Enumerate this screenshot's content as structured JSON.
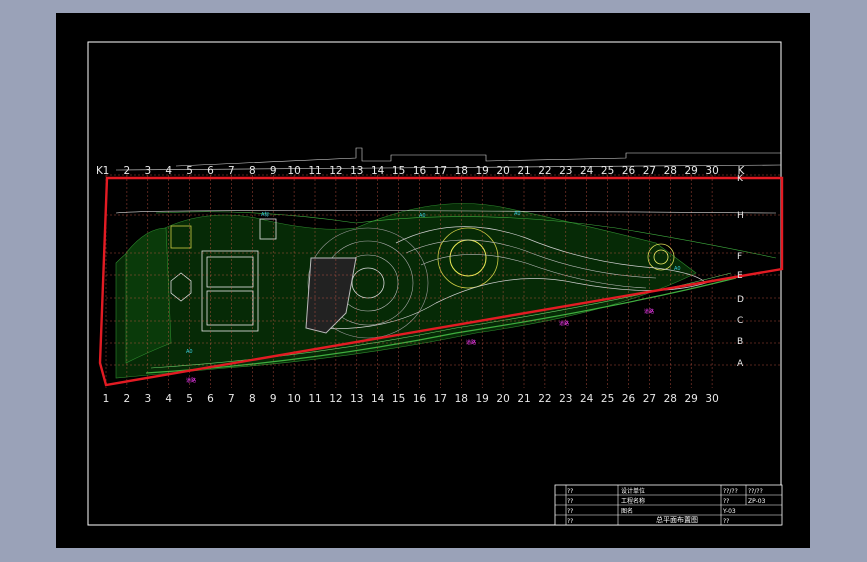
{
  "drawing": {
    "grid_columns_top": [
      "1",
      "2",
      "3",
      "4",
      "5",
      "6",
      "7",
      "8",
      "9",
      "10",
      "11",
      "12",
      "13",
      "14",
      "15",
      "16",
      "17",
      "18",
      "19",
      "20",
      "21",
      "22",
      "23",
      "24",
      "25",
      "26",
      "27",
      "28",
      "29",
      "30",
      "K"
    ],
    "grid_columns_bottom": [
      "1",
      "2",
      "3",
      "4",
      "5",
      "6",
      "7",
      "8",
      "9",
      "10",
      "11",
      "12",
      "13",
      "14",
      "15",
      "16",
      "17",
      "18",
      "19",
      "20",
      "21",
      "22",
      "23",
      "24",
      "25",
      "26",
      "27",
      "28",
      "29",
      "30"
    ],
    "grid_rows_right": [
      "K",
      "H",
      "F",
      "E",
      "D",
      "C",
      "B",
      "A"
    ],
    "grid_rows_left": [
      "K"
    ],
    "annotations": {
      "a_label": "A标",
      "magenta_labels": [
        "道路",
        "道路",
        "道路",
        "道路"
      ],
      "cyan_short": [
        "A0",
        "A0",
        "A0",
        "A0"
      ]
    }
  },
  "title_block": {
    "row_labels": [
      "??",
      "??",
      "??",
      "??"
    ],
    "cells": [
      "设计单位",
      "工程名称",
      "图名",
      "施工图"
    ],
    "title": "总平面布置图",
    "right_top": [
      "??/??",
      "??/??"
    ],
    "right_codes": [
      "ZP-03",
      "??",
      "Y-03",
      "??"
    ]
  },
  "colors": {
    "background": "#000000",
    "frame": "#ffffff",
    "boundary": "#e31b23",
    "grid": "#d45a4a",
    "plant": "#2e8b2e",
    "cyan": "#39d0e0",
    "magenta": "#ff3cff",
    "outer_bg": "#9aa2b8"
  }
}
